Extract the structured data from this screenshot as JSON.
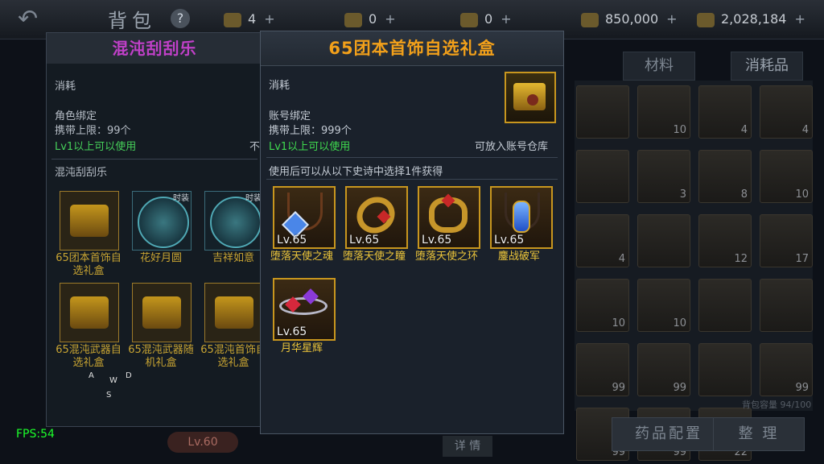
{
  "top_bar": {
    "back_glyph": "↶",
    "title": "背包",
    "help": "?",
    "resources": [
      {
        "icon": "gem-shard-icon",
        "value": "4",
        "plus": "+"
      },
      {
        "icon": "ticket-icon",
        "value": "0",
        "plus": "+"
      },
      {
        "icon": "crystal-icon",
        "value": "0",
        "plus": "+"
      },
      {
        "icon": "gold-coin-icon",
        "value": "850,000",
        "plus": "+"
      },
      {
        "icon": "bound-gold-icon",
        "value": "2,028,184",
        "plus": "+"
      }
    ]
  },
  "inventory_tabs": [
    "材料",
    "消耗品"
  ],
  "inventory_buttons": {
    "potion_config": "药品配置",
    "sort": "整 理"
  },
  "inventory_capacity": "背包容量 94/100",
  "inventory_slot_counts": [
    "",
    "10",
    "4",
    "4",
    "",
    "3",
    "8",
    "10",
    "4",
    "",
    "12",
    "17",
    "10",
    "10",
    "",
    "",
    "99",
    "99",
    "",
    "99",
    "99",
    "99",
    "22"
  ],
  "lv_badge": "Lv.60",
  "detail_button": "详 情",
  "fps": "FPS:54",
  "left_tooltip": {
    "title": "混沌刮刮乐",
    "type": "消耗",
    "bind": "角色绑定",
    "carry_limit": "携带上限：99个",
    "usable": "Lv1以上可以使用",
    "usable_tail": "不",
    "section_title": "混沌刮刮乐",
    "items": [
      {
        "name": "65团本首饰自选礼盒",
        "kind": "chest",
        "tag": ""
      },
      {
        "name": "花好月圆",
        "kind": "disc",
        "tag": "时装"
      },
      {
        "name": "吉祥如意",
        "kind": "disc",
        "tag": "时装"
      },
      {
        "name": "65混沌武器自选礼盒",
        "kind": "chest",
        "tag": ""
      },
      {
        "name": "65混沌武器随机礼盒",
        "kind": "chest",
        "tag": ""
      },
      {
        "name": "65混沌首饰自选礼盒",
        "kind": "chest",
        "tag": ""
      }
    ],
    "wasd": {
      "w": "W",
      "a": "A",
      "d": "D",
      "s": "S"
    }
  },
  "main_tooltip": {
    "title": "65团本首饰自选礼盒",
    "type": "消耗",
    "bind": "账号绑定",
    "carry_limit": "携带上限：999个",
    "usable": "Lv1以上可以使用",
    "storage": "可放入账号仓库",
    "description": "使用后可以从以下史诗中选择1件获得",
    "rewards": [
      {
        "name": "堕落天使之魂",
        "level": "Lv.65",
        "icon": "necklace-icon",
        "gem": "#4a86e8"
      },
      {
        "name": "堕落天使之瞳",
        "level": "Lv.65",
        "icon": "bracelet-icon",
        "gem": "#c82828"
      },
      {
        "name": "堕落天使之环",
        "level": "Lv.65",
        "icon": "ring-icon",
        "gem": "#c82828"
      },
      {
        "name": "鏖战破军",
        "level": "Lv.65",
        "icon": "pendant-icon",
        "gem": "#3c7cf0"
      },
      {
        "name": "月华星辉",
        "level": "Lv.65",
        "icon": "bangle-icon",
        "gem": "#d6283c"
      }
    ]
  }
}
